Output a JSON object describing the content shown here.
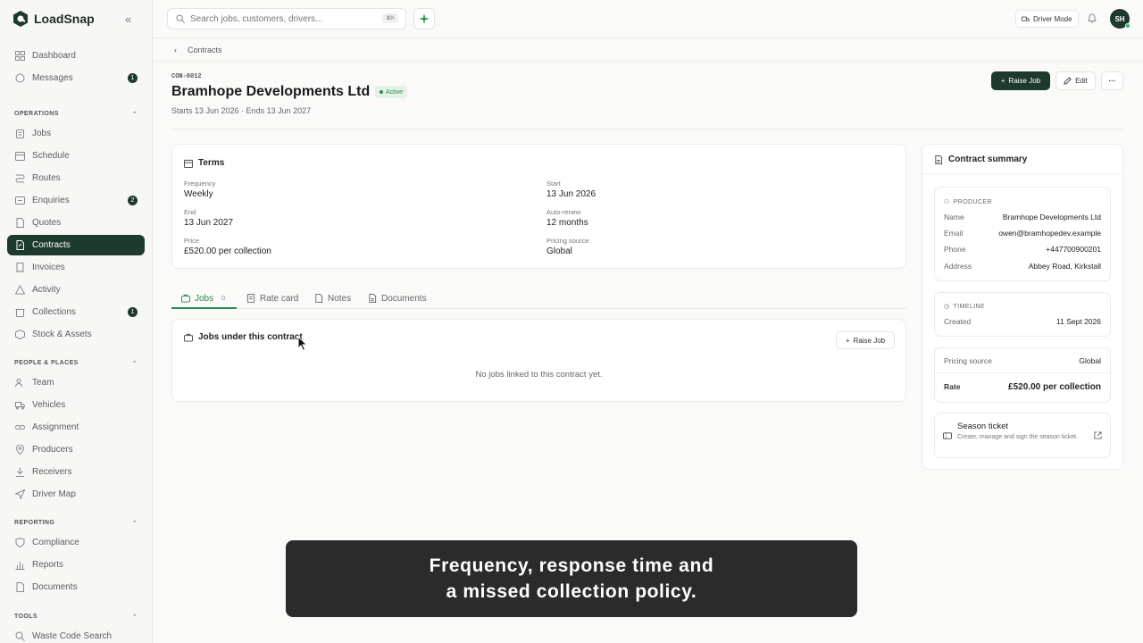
{
  "app": {
    "name": "LoadSnap"
  },
  "sidebar": {
    "top_items": [
      {
        "label": "Dashboard"
      },
      {
        "label": "Messages",
        "badge": "1"
      }
    ],
    "sections": [
      {
        "title": "OPERATIONS",
        "items": [
          {
            "label": "Jobs"
          },
          {
            "label": "Schedule"
          },
          {
            "label": "Routes"
          },
          {
            "label": "Enquiries",
            "badge": "2"
          },
          {
            "label": "Quotes"
          },
          {
            "label": "Contracts",
            "active": true
          },
          {
            "label": "Invoices"
          },
          {
            "label": "Activity"
          },
          {
            "label": "Collections",
            "badge": "1"
          },
          {
            "label": "Stock & Assets"
          }
        ]
      },
      {
        "title": "PEOPLE & PLACES",
        "items": [
          {
            "label": "Team"
          },
          {
            "label": "Vehicles"
          },
          {
            "label": "Assignment"
          },
          {
            "label": "Producers"
          },
          {
            "label": "Receivers"
          },
          {
            "label": "Driver Map"
          }
        ]
      },
      {
        "title": "REPORTING",
        "items": [
          {
            "label": "Compliance"
          },
          {
            "label": "Reports"
          },
          {
            "label": "Documents"
          }
        ]
      },
      {
        "title": "TOOLS",
        "items": [
          {
            "label": "Waste Code Search"
          }
        ]
      }
    ]
  },
  "topbar": {
    "search_placeholder": "Search jobs, customers, drivers...",
    "search_shortcut": "⌘K",
    "driver_mode_label": "Driver Mode",
    "user_initials": "SH"
  },
  "breadcrumb": {
    "label": "Contracts"
  },
  "contract": {
    "code": "CON-0012",
    "title": "Bramhope Developments Ltd",
    "status": "Active",
    "dates": "Starts 13 Jun 2026 · Ends 13 Jun 2027",
    "raise_job_label": "Raise Job",
    "edit_label": "Edit"
  },
  "terms": {
    "title": "Terms",
    "frequency_label": "Frequency",
    "frequency": "Weekly",
    "start_label": "Start",
    "start": "13 Jun 2026",
    "end_label": "End",
    "end": "13 Jun 2027",
    "auto_renew_label": "Auto-renew",
    "auto_renew": "12 months",
    "price_label": "Price",
    "price": "£520.00 per collection",
    "pricing_source_label": "Pricing source",
    "pricing_source": "Global"
  },
  "tabs": [
    {
      "label": "Jobs",
      "count": "0"
    },
    {
      "label": "Rate card"
    },
    {
      "label": "Notes"
    },
    {
      "label": "Documents"
    }
  ],
  "jobs_panel": {
    "title": "Jobs under this contract",
    "raise_job_label": "Raise Job",
    "empty_text": "No jobs linked to this contract yet."
  },
  "summary": {
    "title": "Contract summary",
    "producer_heading": "PRODUCER",
    "name_label": "Name",
    "name": "Bramhope Developments Ltd",
    "email_label": "Email",
    "email": "owen@bramhopedev.example",
    "phone_label": "Phone",
    "phone": "+447700900201",
    "address_label": "Address",
    "address": "Abbey Road, Kirkstall",
    "timeline_heading": "TIMELINE",
    "created_label": "Created",
    "created": "11 Sept 2026",
    "pricing_source_label": "Pricing source",
    "pricing_source": "Global",
    "rate_label": "Rate",
    "rate": "£520.00 per collection",
    "season_ticket_title": "Season ticket",
    "season_ticket_desc": "Create, manage and sign the season ticket."
  },
  "caption": {
    "line1": "Frequency, response time and",
    "line2": "a missed collection policy."
  },
  "colors": {
    "brand_dark": "#1e3a2c",
    "accent_green": "#2a8a4c"
  }
}
